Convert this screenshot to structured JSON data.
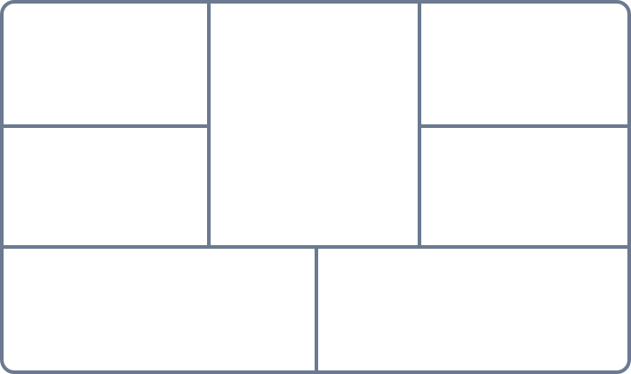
{
  "layout_diagram": {
    "stroke_color": "#6b7a90",
    "background_color": "#ffffff",
    "regions": [
      {
        "name": "top-left-cell",
        "label": ""
      },
      {
        "name": "middle-left-cell",
        "label": ""
      },
      {
        "name": "center-tall-cell",
        "label": ""
      },
      {
        "name": "top-right-cell",
        "label": ""
      },
      {
        "name": "middle-right-cell",
        "label": ""
      },
      {
        "name": "bottom-left-cell",
        "label": ""
      },
      {
        "name": "bottom-right-cell",
        "label": ""
      }
    ]
  }
}
